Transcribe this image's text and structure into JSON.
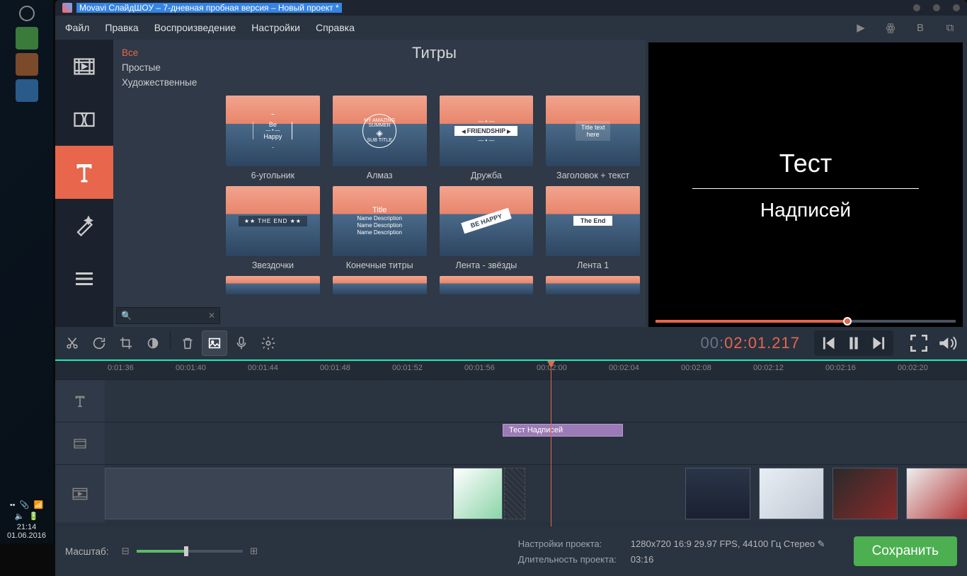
{
  "os": {
    "time": "21:14",
    "date": "01.06.2016"
  },
  "title": "Movavi СлайдШОУ – 7-дневная пробная версия – Новый проект *",
  "menu": {
    "file": "Файл",
    "edit": "Правка",
    "playback": "Воспроизведение",
    "settings": "Настройки",
    "help": "Справка"
  },
  "titles_panel": {
    "header": "Титры",
    "categories": {
      "all": "Все",
      "simple": "Простые",
      "artistic": "Художественные"
    },
    "items": {
      "0": {
        "label": "6-угольник",
        "sample_top": "Be",
        "sample_bot": "Happy"
      },
      "1": {
        "label": "Алмаз",
        "sample_top": "MY AMAZING SUMMER",
        "sample_bot": "SUB TITLE"
      },
      "2": {
        "label": "Дружба",
        "sample": "FRIENDSHIP"
      },
      "3": {
        "label": "Заголовок + текст",
        "sample_top": "Title text",
        "sample_bot": "here"
      },
      "4": {
        "label": "Звездочки",
        "sample": "THE END"
      },
      "5": {
        "label": "Конечные титры",
        "sample_title": "Title",
        "sample_desc": "Name Description"
      },
      "6": {
        "label": "Лента - звёзды",
        "sample": "BE HAPPY"
      },
      "7": {
        "label": "Лента 1",
        "sample": "The End"
      }
    }
  },
  "preview": {
    "line1": "Тест",
    "line2": "Надписей"
  },
  "timecode": {
    "prefix": "00:",
    "main": "02:01",
    "frac": ".217"
  },
  "ruler": {
    "0": "0:01:36",
    "1": "00:01:40",
    "2": "00:01:44",
    "3": "00:01:48",
    "4": "00:01:52",
    "5": "00:01:56",
    "6": "00:02:00",
    "7": "00:02:04",
    "8": "00:02:08",
    "9": "00:02:12",
    "10": "00:02:16",
    "11": "00:02:20"
  },
  "timeline": {
    "title_clip": "Тест Надписей"
  },
  "bottom": {
    "zoom_label": "Масштаб:",
    "proj_settings_label": "Настройки проекта:",
    "proj_settings_value": "1280x720 16:9 29.97 FPS, 44100 Гц Стерео",
    "duration_label": "Длительность проекта:",
    "duration_value": "03:16",
    "save": "Сохранить"
  }
}
